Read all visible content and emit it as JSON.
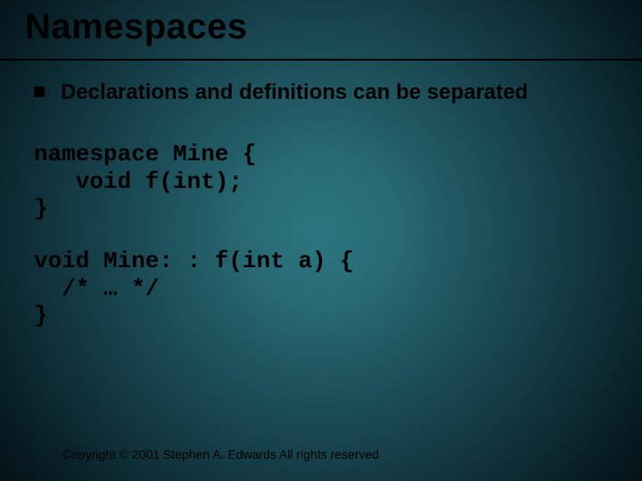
{
  "title": "Namespaces",
  "bullet": "Declarations and definitions can be separated",
  "code_block_1": "namespace Mine {\n   void f(int);\n}",
  "code_block_2": "void Mine: : f(int a) {\n  /* … */\n}",
  "footer": "Copyright © 2001 Stephen A. Edwards  All rights reserved"
}
